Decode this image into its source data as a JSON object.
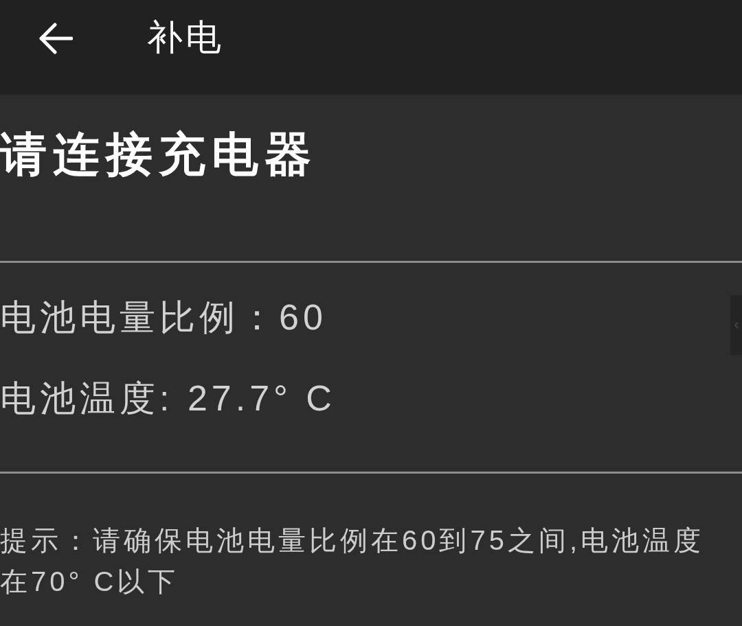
{
  "header": {
    "title": "补电"
  },
  "prompt": {
    "title": "请连接充电器"
  },
  "battery": [
    "电池电量比例：60",
    "电池温度: 27.7° C"
  ],
  "tip": "提示：请确保电池电量比例在60到75之间,电池温度在70° C以下"
}
